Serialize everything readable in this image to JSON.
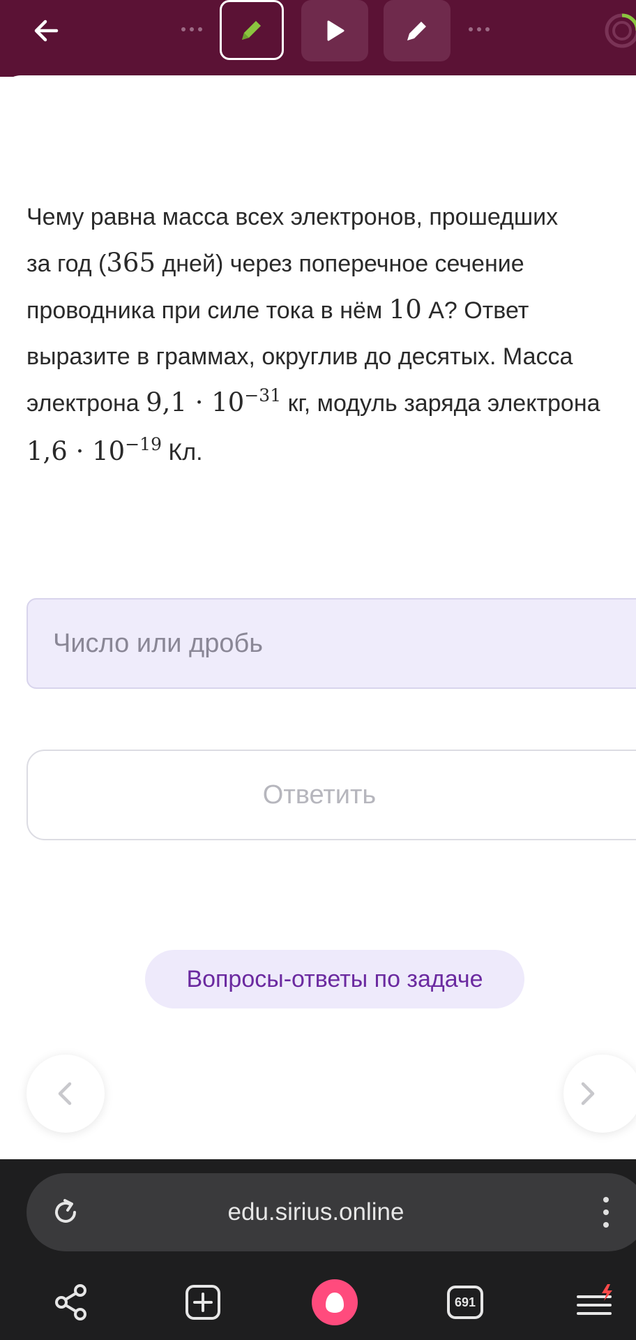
{
  "header": {
    "back_label": "back",
    "tools": [
      "pencil-active",
      "play",
      "pencil"
    ]
  },
  "problem": {
    "line1": "Чему равна масса всех электронов, прошедших",
    "line2_pre": "за год (",
    "line2_num": "365",
    "line2_post": " дней) через поперечное сечение",
    "line3_pre": "проводника при силе тока в нём ",
    "line3_num": "10",
    "line3_post": " А? Ответ",
    "line4": "выразите в граммах, округлив до десятых. Масса",
    "line5_pre": "электрона ",
    "line5_mass": "9,1 · 10",
    "line5_exp": "−31",
    "line5_post": " кг, модуль заряда электрона",
    "line6_charge": "1,6 · 10",
    "line6_exp": "−19",
    "line6_post": " Кл."
  },
  "answer": {
    "placeholder": "Число или дробь",
    "submit_label": "Ответить"
  },
  "qa_button": "Вопросы-ответы по задаче",
  "browser": {
    "url": "edu.sirius.online",
    "tabs_count": "691"
  },
  "colors": {
    "header_bg": "#5b1235",
    "accent_green": "#8bc53f",
    "accent_purple": "#6b2aa0",
    "alice_pink": "#ff4b7d"
  }
}
